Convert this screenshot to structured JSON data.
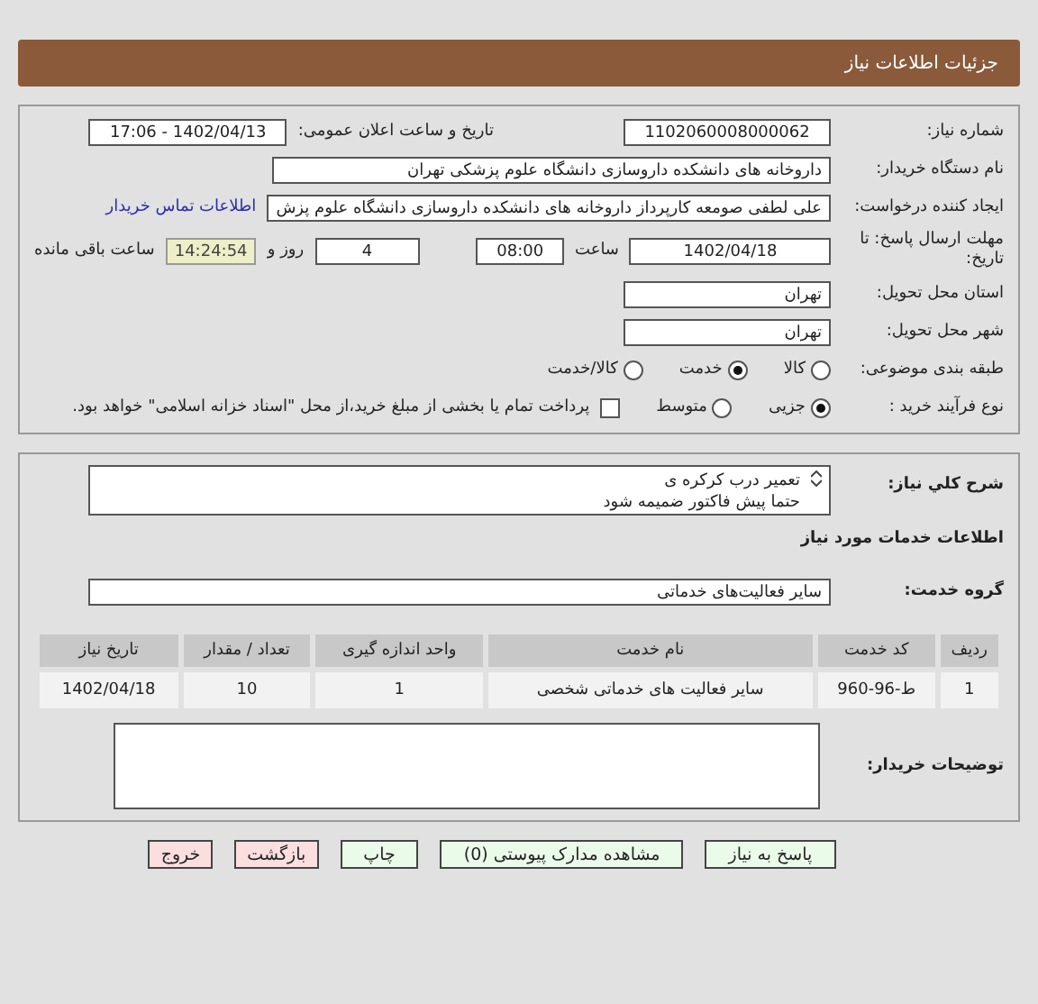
{
  "header": {
    "title": "جزئیات اطلاعات نیاز"
  },
  "details": {
    "need_number": {
      "label": "شماره نیاز:",
      "value": "1102060008000062"
    },
    "announce": {
      "label": "تاریخ و ساعت اعلان عمومی:",
      "value": "1402/04/13 - 17:06"
    },
    "buyer_org": {
      "label": "نام دستگاه خریدار:",
      "value": "داروخانه های دانشکده داروسازی دانشگاه علوم پزشکی تهران"
    },
    "requester": {
      "label": "ایجاد کننده درخواست:",
      "value": "علی لطفی صومعه کارپرداز داروخانه های دانشکده داروسازی دانشگاه علوم پزش",
      "link": "اطلاعات تماس خریدار"
    },
    "deadline": {
      "label": "مهلت ارسال پاسخ: تا تاریخ:",
      "date": "1402/04/18",
      "time_label": "ساعت",
      "time": "08:00",
      "days": "4",
      "days_label": "روز و",
      "remaining": "14:24:54",
      "remaining_label": "ساعت باقی مانده"
    },
    "province": {
      "label": "استان محل تحویل:",
      "value": "تهران"
    },
    "city": {
      "label": "شهر محل تحویل:",
      "value": "تهران"
    },
    "category": {
      "label": "طبقه بندی موضوعی:",
      "options": [
        {
          "label": "کالا",
          "selected": false
        },
        {
          "label": "خدمت",
          "selected": true
        },
        {
          "label": "کالا/خدمت",
          "selected": false
        }
      ]
    },
    "purchase_type": {
      "label": "نوع فرآیند خرید :",
      "options": [
        {
          "label": "جزیی",
          "selected": true
        },
        {
          "label": "متوسط",
          "selected": false
        }
      ],
      "payment": {
        "label": "پرداخت تمام یا بخشی از مبلغ خرید،از محل \"اسناد خزانه اسلامی\" خواهد بود.",
        "checked": false
      }
    }
  },
  "services": {
    "description": {
      "label": "شرح کلي نياز:",
      "lines": [
        "تعمیر درب کرکره ی",
        "حتما پیش فاکتور ضمیمه شود"
      ]
    },
    "section_title": "اطلاعات خدمات مورد نیاز",
    "service_group": {
      "label": "گروه خدمت:",
      "value": "سایر فعالیت‌های خدماتی"
    },
    "table": {
      "columns": [
        "ردیف",
        "کد خدمت",
        "نام خدمت",
        "واحد اندازه گیری",
        "تعداد / مقدار",
        "تاریخ نیاز"
      ],
      "rows": [
        [
          "1",
          "ط-96-960",
          "سایر فعالیت های خدماتی شخصی",
          "1",
          "10",
          "1402/04/18"
        ]
      ]
    },
    "buyer_notes": {
      "label": "توضیحات خریدار:"
    }
  },
  "buttons": [
    {
      "label": "پاسخ به نیاز",
      "kind": "normal"
    },
    {
      "label": "مشاهده مدارک پیوستی (0)",
      "kind": "normal"
    },
    {
      "label": "چاپ",
      "kind": "normal"
    },
    {
      "label": "بازگشت",
      "kind": "warning"
    },
    {
      "label": "خروج",
      "kind": "warning"
    }
  ]
}
